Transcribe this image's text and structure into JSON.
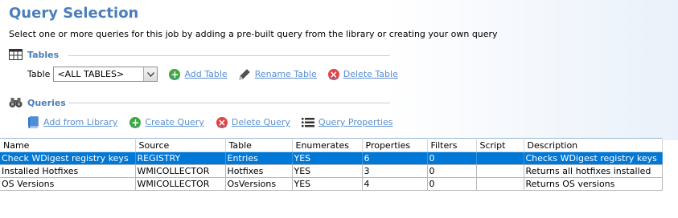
{
  "header": {
    "title": "Query Selection",
    "subtitle": "Select one or more queries for this job by adding a pre-built query from the library or creating your own query"
  },
  "tables_section": {
    "heading": "Tables",
    "table_label": "Table",
    "selected_table": "<ALL TABLES>",
    "add_label": "Add Table",
    "rename_label": "Rename Table",
    "delete_label": "Delete Table"
  },
  "queries_section": {
    "heading": "Queries",
    "add_from_library": "Add from Library",
    "create_query": "Create Query",
    "delete_query": "Delete Query",
    "query_properties": "Query Properties"
  },
  "grid": {
    "columns": [
      "Name",
      "Source",
      "Table",
      "Enumerates",
      "Properties",
      "Filters",
      "Script",
      "Description"
    ],
    "rows": [
      {
        "name": "Check WDigest registry keys",
        "source": "REGISTRY",
        "table": "Entries",
        "enumerates": "YES",
        "properties": "6",
        "filters": "0",
        "script": "",
        "description": "Checks WDigest registry keys"
      },
      {
        "name": "Installed Hotfixes",
        "source": "WMICOLLECTOR",
        "table": "Hotfixes",
        "enumerates": "YES",
        "properties": "3",
        "filters": "0",
        "script": "",
        "description": "Returns all hotfixes installed"
      },
      {
        "name": "OS Versions",
        "source": "WMICOLLECTOR",
        "table": "OsVersions",
        "enumerates": "YES",
        "properties": "4",
        "filters": "0",
        "script": "",
        "description": "Returns OS versions"
      }
    ]
  },
  "colors": {
    "accent": "#4a7ebb",
    "link": "#5b8fd0",
    "selection": "#0078d7",
    "add_green": "#3ea83e",
    "delete_red": "#e04444"
  },
  "icons": {
    "tables": "table-grid-icon",
    "queries": "binoculars-icon",
    "add": "plus-circle-icon",
    "rename": "pencil-icon",
    "delete": "x-circle-icon",
    "library": "book-icon",
    "properties": "list-icon"
  }
}
